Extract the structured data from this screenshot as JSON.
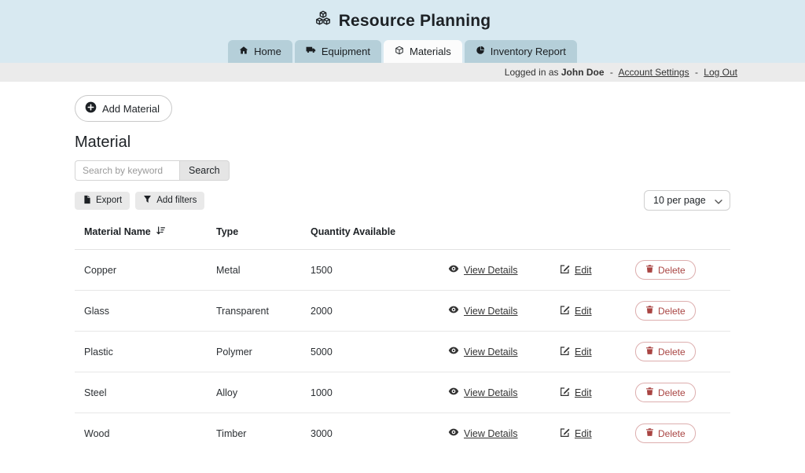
{
  "app": {
    "title": "Resource Planning"
  },
  "nav": {
    "tabs": [
      {
        "label": "Home",
        "icon": "house-icon",
        "active": false
      },
      {
        "label": "Equipment",
        "icon": "truck-icon",
        "active": false
      },
      {
        "label": "Materials",
        "icon": "box-icon",
        "active": true
      },
      {
        "label": "Inventory Report",
        "icon": "pie-chart-icon",
        "active": false
      }
    ]
  },
  "user_bar": {
    "prefix": "Logged in as",
    "username": "John Doe",
    "separator": "-",
    "account_settings_label": "Account Settings",
    "log_out_label": "Log Out"
  },
  "main": {
    "add_material_label": "Add Material",
    "page_title": "Material",
    "search": {
      "placeholder": "Search by keyword",
      "value": "",
      "button_label": "Search"
    },
    "toolbar": {
      "export_label": "Export",
      "filters_label": "Add filters"
    },
    "pagination": {
      "per_page_selected": "10 per page"
    }
  },
  "table": {
    "columns": [
      "Material Name",
      "Type",
      "Quantity Available"
    ],
    "sort": {
      "column": "Material Name",
      "direction": "ascending"
    },
    "actions": {
      "view_label": "View Details",
      "edit_label": "Edit",
      "delete_label": "Delete"
    },
    "rows": [
      {
        "name": "Copper",
        "type": "Metal",
        "quantity": 1500
      },
      {
        "name": "Glass",
        "type": "Transparent",
        "quantity": 2000
      },
      {
        "name": "Plastic",
        "type": "Polymer",
        "quantity": 5000
      },
      {
        "name": "Steel",
        "type": "Alloy",
        "quantity": 1000
      },
      {
        "name": "Wood",
        "type": "Timber",
        "quantity": 3000
      }
    ]
  },
  "colors": {
    "header_bg": "#d8e9f1",
    "tab_inactive_bg": "#b5cfd9",
    "tab_active_bg": "#fcfcfc",
    "user_bar_bg": "#ebebeb",
    "button_gray_bg": "#e9e9e9",
    "delete_red": "#a94442",
    "delete_border": "#ddaeae",
    "text": "#212529",
    "divider": "#e7e7e7"
  }
}
